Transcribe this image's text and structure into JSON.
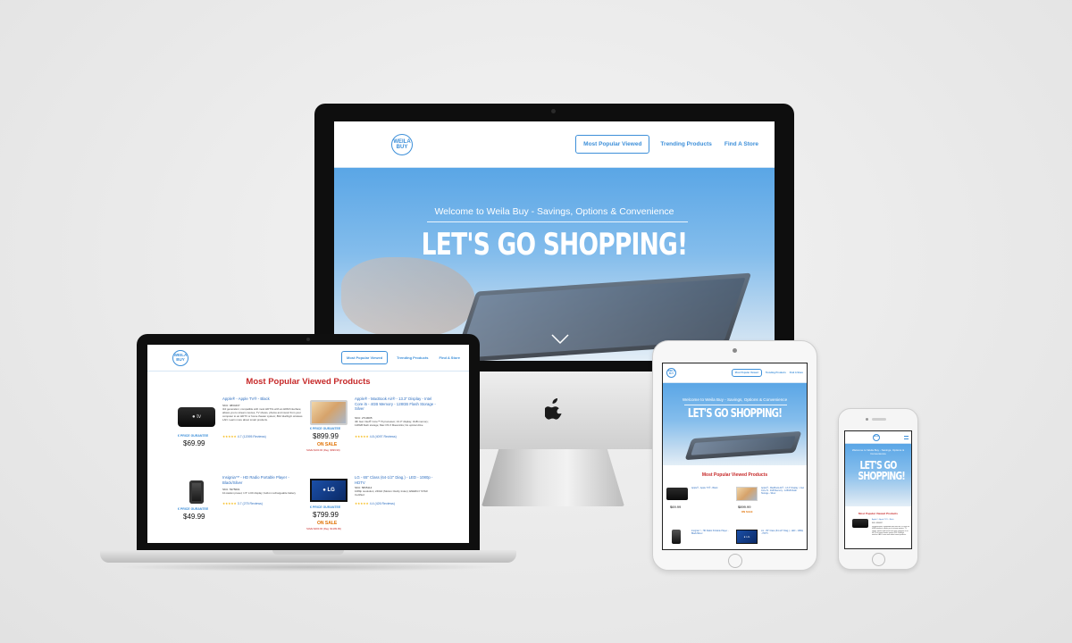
{
  "site": {
    "logo_top": "WEILA",
    "logo_bottom": "BUY",
    "nav": [
      "Most Popular Viewed",
      "Trending Products",
      "Find A Store"
    ],
    "hero_subtitle": "Welcome to Weila Buy - Savings, Options & Convenience",
    "hero_title": "LET'S GO SHOPPING!",
    "section_title": "Most Popular Viewed Products",
    "price_guarantee": "€ PRICE GURANTEE",
    "on_sale_label": "ON SALE"
  },
  "imac": {
    "brand_icon": "apple-logo-icon"
  },
  "products": [
    {
      "name": "Apple® - Apple TV® - Black",
      "sku": "SKU: 4834437",
      "description": "3rd generation; compatible with most HDTVs with an HDMI interface; allows you to stream movies, TV shows, photos and music from your computer to an HDTV or home theater system; 802.11a/b/g/n wireless LAN. Learn more about smart products.",
      "stars": "★★★★★",
      "rating": "4.7 (12095 Reviews)",
      "price": "$69.99",
      "on_sale": false,
      "save": ""
    },
    {
      "name": "Apple® - MacBook Air® - 13.3\" Display - Intel Core i5 - 4GB Memory - 128GB Flash Storage - Silver",
      "sku": "SKU: 2713005",
      "description": "4th Gen Intel® Core™ i5 processor; 13.3\" display; 4GB memory; 128GB flash storage; Mac OS X Mavericks; No optical drive",
      "stars": "★★★★★",
      "rating": "4.8 (4097 Reviews)",
      "price": "$899.99",
      "on_sale": true,
      "save": "SAVE $100.00 (Reg. $999.99)"
    },
    {
      "name": "Insignia™ - HD Radio Portable Player - Black/Silver",
      "sku": "SKU: 5375001",
      "description": "10-station preset; 1.5\" LCD display; built-in rechargeable battery",
      "stars": "★★★★★",
      "rating": "3.7 (275 Reviews)",
      "price": "$49.99",
      "on_sale": false,
      "save": ""
    },
    {
      "name": "LG - 65\" Class (64-1/2\" Diag.) - LED - 1080p - HDTV",
      "sku": "SKU: 5835114",
      "description": "1080p resolution; 240Hz (Motion Clarity Index); ENERGY STAR Certified",
      "stars": "★★★★★",
      "rating": "4.4 (426 Reviews)",
      "price": "$799.99",
      "on_sale": true,
      "save": "SAVE $400.00 (Reg. $1199.99)"
    }
  ],
  "thumb_labels": {
    "appletv": "● tv",
    "lg": "● LG"
  },
  "iphone": {
    "hero_title": "LET'S GO SHOPPING!",
    "hero_subtitle": "Welcome to Weila Buy - Savings, Options & Convenience",
    "product_name": "Apple® - Apple TV® - Black",
    "product_sku": "SKU: 4834437"
  },
  "colors": {
    "accent": "#3d8fd9",
    "title_red": "#c62828",
    "sale_orange": "#e07000",
    "hero_top": "#5aa6e6"
  }
}
